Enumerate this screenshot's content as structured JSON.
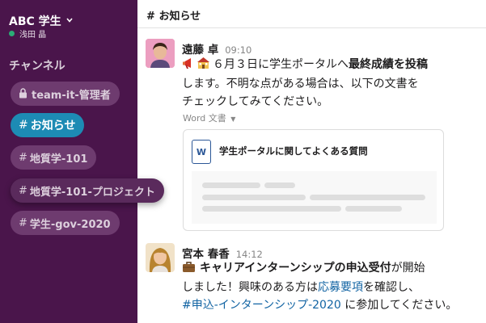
{
  "workspace": {
    "name": "ABC 学生",
    "user": "浅田 晶"
  },
  "sidebar": {
    "section_title": "チャンネル",
    "channels": [
      {
        "label": "team-it-管理者",
        "private": true
      },
      {
        "label": "お知らせ",
        "active": true
      },
      {
        "label": "地質学-101"
      },
      {
        "label": "地質学-101-プロジェクト",
        "hover": true
      },
      {
        "label": "学生-gov-2020"
      }
    ]
  },
  "header": {
    "hash": "#",
    "title": "お知らせ"
  },
  "messages": [
    {
      "author": "遠藤 卓",
      "time": "09:10",
      "line1_pre": "６月３日に学生ポータルへ",
      "line1_bold": "最終成績を投稿",
      "line2": "します。不明な点がある場合は、以下の文書を",
      "line3": "チェックしてみてください。",
      "attachment_type": "Word 文書",
      "attachment_title": "学生ポータルに関してよくある質問"
    },
    {
      "author": "宮本 春香",
      "time": "14:12",
      "line1_bold": "キャリアインターンシップの申込受付",
      "line1_post": "が開始",
      "line2_pre": "しました！興味のある方は",
      "line2_link": "応募要項",
      "line2_post": "を確認し、",
      "line3_link": "#申込-インターンシップ-2020",
      "line3_post": " に参加してください。"
    }
  ],
  "colors": {
    "sidebar": "#4a154b",
    "active_channel": "#1d8bb4",
    "link": "#1264a3",
    "presence": "#2bac76"
  },
  "icons": [
    "chevron-down-icon",
    "lock-icon",
    "megaphone-icon",
    "school-icon",
    "briefcase-icon",
    "word-document-icon",
    "caret-down-icon"
  ]
}
